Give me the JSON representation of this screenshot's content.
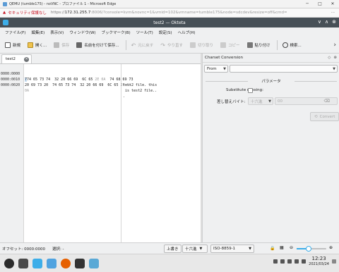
{
  "browser": {
    "tab_title": "QEMU (tumble175) - noVNC - プロファイル 1 - Microsoft Edge",
    "warning_icon": "warning-triangle-icon",
    "security_label": "セキュリティ保護なし",
    "url_prefix": "https://",
    "url_host": "172.31.255.7",
    "url_rest": ":8006/?console=kvm&novnc=1&vmid=102&vmname=tumble175&node=sdcdev&resize=off&cmd=",
    "window_buttons": [
      "─",
      "□",
      "✕"
    ]
  },
  "app": {
    "title": "test2 — Okteta",
    "window_buttons": [
      "∨",
      "∧",
      "⊗"
    ]
  },
  "menubar": {
    "items": [
      "ファイル(F)",
      "編集(E)",
      "表示(V)",
      "ウィンドウ(W)",
      "ブックマーク(B)",
      "ツール(T)",
      "設定(S)",
      "ヘルプ(H)"
    ]
  },
  "toolbar": {
    "new_label": "新規",
    "open_label": "開く...",
    "save_label": "保存",
    "saveas_label": "名前を付けて保存...",
    "undo_label": "元に戻す",
    "redo_label": "やり直す",
    "cut_label": "切り取り",
    "copy_label": "コピー",
    "paste_label": "貼り付け",
    "search_label": "検索...",
    "more_icon": "›"
  },
  "editor": {
    "tab_label": "test2",
    "rows": [
      {
        "addr": "0000:0000",
        "hex": "74 65 73 74  32 20 66 69  6C 65 ",
        "hex_dim": "2E 0A ",
        "hex_tail": " 74 68 69 73",
        "chars": "test2 file. this"
      },
      {
        "addr": "0000:0010",
        "hex": "20 69 73 20  74 65 73 74  32 20 66 69  6C 65 ",
        "hex_dim": "2E 0A",
        "hex_tail": "",
        "chars": " is test2 file.."
      },
      {
        "addr": "0000:0020",
        "hex": "",
        "hex_dim": "0A",
        "hex_tail": "",
        "chars": "."
      }
    ]
  },
  "panel": {
    "title": "Charset Conversion",
    "direction_value": "From",
    "charset_value": "",
    "params_label": "パラメータ",
    "substitute_label": "Substitute missing:",
    "substitute_checked": false,
    "replace_label": "差し替えバイト:",
    "replace_base": "十六進",
    "replace_value": "00",
    "convert_label": "Convert"
  },
  "status": {
    "offset_label": "オフセット: 0000:0000",
    "selection_label": "選択: -",
    "mode_label": "上書き",
    "encoding_label": "十六進",
    "charset_label": "ISO-8859-1",
    "zoom_level": 0.4
  },
  "taskbar": {
    "time": "12:23",
    "date": "2021/03/24"
  },
  "colors": {
    "okteta_title_bg": "#475057",
    "accent": "#3daee9",
    "warning": "#c50f1f"
  }
}
